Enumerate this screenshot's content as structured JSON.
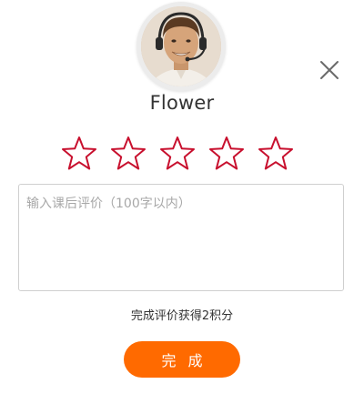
{
  "user": {
    "name": "Flower"
  },
  "rating": {
    "max": 5,
    "selected": 0,
    "star_color": "#c8102e"
  },
  "review": {
    "placeholder": "输入课后评价（100字以内）",
    "value": ""
  },
  "hint": {
    "text": "完成评价获得2积分"
  },
  "submit": {
    "label": "完 成",
    "color": "#ff6a00"
  },
  "icons": {
    "close": "close-icon",
    "star": "star-outline-icon",
    "avatar": "user-avatar"
  }
}
